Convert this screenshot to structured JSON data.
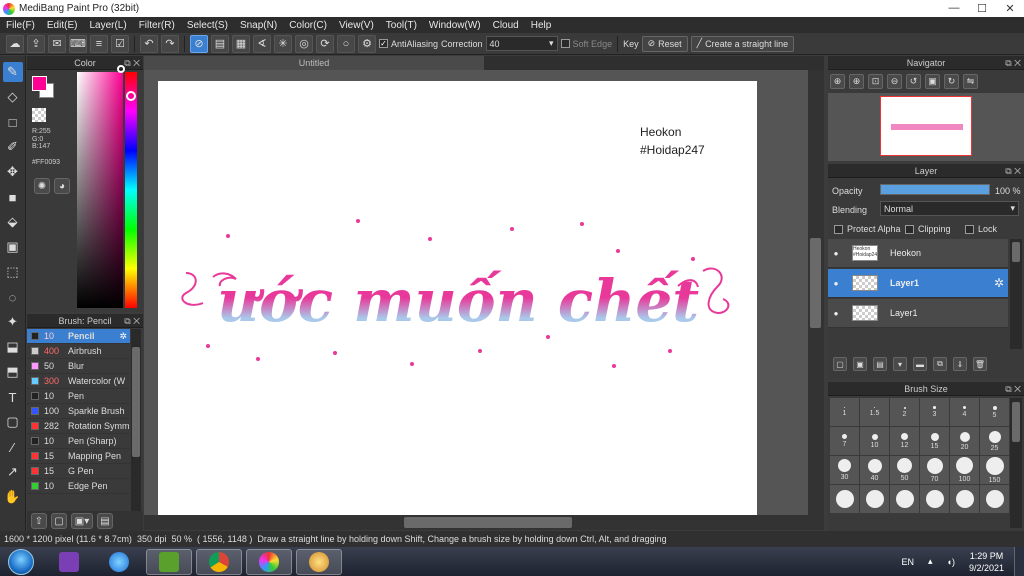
{
  "window": {
    "title": "MediBang Paint Pro (32bit)",
    "controls": [
      "—",
      "☐",
      "✕"
    ]
  },
  "menu": [
    "File(F)",
    "Edit(E)",
    "Layer(L)",
    "Filter(R)",
    "Select(S)",
    "Snap(N)",
    "Color(C)",
    "View(V)",
    "Tool(T)",
    "Window(W)",
    "Cloud",
    "Help"
  ],
  "toolbar": {
    "antialiasing_label": "AntiAliasing",
    "correction_label": "Correction",
    "correction_value": "40",
    "soft_edge_label": "Soft Edge",
    "key_label": "Key",
    "reset_label": "Reset",
    "straight_line_label": "Create a straight line"
  },
  "color_panel": {
    "title": "Color",
    "foreground_color": "#ff0093",
    "background_color": "#ffffff",
    "rgb_r": "R:255",
    "rgb_g": "G:0",
    "rgb_b": "B:147",
    "hex": "#FF0093"
  },
  "brush_panel": {
    "title": "Brush: Pencil",
    "brushes": [
      {
        "size": "10",
        "name": "Pencil",
        "color": "#222222",
        "size_color": "#ff6a6a",
        "selected": true
      },
      {
        "size": "400",
        "name": "Airbrush",
        "color": "#cccccc",
        "size_color": "#ff6a6a",
        "selected": false
      },
      {
        "size": "50",
        "name": "Blur",
        "color": "#ff99ff",
        "size_color": "#dddddd",
        "selected": false
      },
      {
        "size": "300",
        "name": "Watercolor (W",
        "color": "#66ccff",
        "size_color": "#ff6a6a",
        "selected": false
      },
      {
        "size": "10",
        "name": "Pen",
        "color": "#222222",
        "size_color": "#dddddd",
        "selected": false
      },
      {
        "size": "100",
        "name": "Sparkle Brush",
        "color": "#3355ff",
        "size_color": "#dddddd",
        "selected": false
      },
      {
        "size": "282",
        "name": "Rotation Symm",
        "color": "#ff3333",
        "size_color": "#dddddd",
        "selected": false
      },
      {
        "size": "10",
        "name": "Pen (Sharp)",
        "color": "#222222",
        "size_color": "#dddddd",
        "selected": false
      },
      {
        "size": "15",
        "name": "Mapping Pen",
        "color": "#ff3333",
        "size_color": "#dddddd",
        "selected": false
      },
      {
        "size": "15",
        "name": "G Pen",
        "color": "#ff3333",
        "size_color": "#dddddd",
        "selected": false
      },
      {
        "size": "10",
        "name": "Edge Pen",
        "color": "#33cc33",
        "size_color": "#dddddd",
        "selected": false
      }
    ]
  },
  "canvas": {
    "tab_title": "Untitled",
    "watermark_line1": "Heokon",
    "watermark_line2": "#Hoidap247",
    "artwork_text": "ước muốn chết",
    "artwork_colors": {
      "pink": "#e8399a",
      "blue": "#a9c8ea"
    }
  },
  "navigator": {
    "title": "Navigator"
  },
  "layer_panel": {
    "title": "Layer",
    "opacity_label": "Opacity",
    "opacity_value": "100 %",
    "opacity_fraction": 1.0,
    "blending_label": "Blending",
    "blending_value": "Normal",
    "protect_alpha_label": "Protect Alpha",
    "clipping_label": "Clipping",
    "lock_label": "Lock",
    "layers": [
      {
        "name": "Heokon",
        "thumb_text": "Heokon #Hoidap247",
        "selected": false
      },
      {
        "name": "Layer1",
        "thumb_text": "",
        "selected": true
      },
      {
        "name": "Layer1",
        "thumb_text": "",
        "selected": false
      }
    ]
  },
  "brush_size_panel": {
    "title": "Brush Size",
    "sizes": [
      "1",
      "1.5",
      "2",
      "3",
      "4",
      "5",
      "7",
      "10",
      "12",
      "15",
      "20",
      "25",
      "30",
      "40",
      "50",
      "70",
      "100",
      "150",
      "",
      "",
      "",
      "",
      "",
      ""
    ]
  },
  "status_bar": {
    "dimensions": "1600 * 1200 pixel",
    "physical_size": "(11.6 * 8.7cm)",
    "dpi": "350 dpi",
    "zoom": "50 %",
    "cursor": "( 1556, 1148 )",
    "hint": "Draw a straight line by holding down Shift, Change a brush size by holding down Ctrl, Alt, and dragging"
  },
  "taskbar": {
    "language": "EN",
    "time": "1:29 PM",
    "date": "9/2/2021"
  }
}
